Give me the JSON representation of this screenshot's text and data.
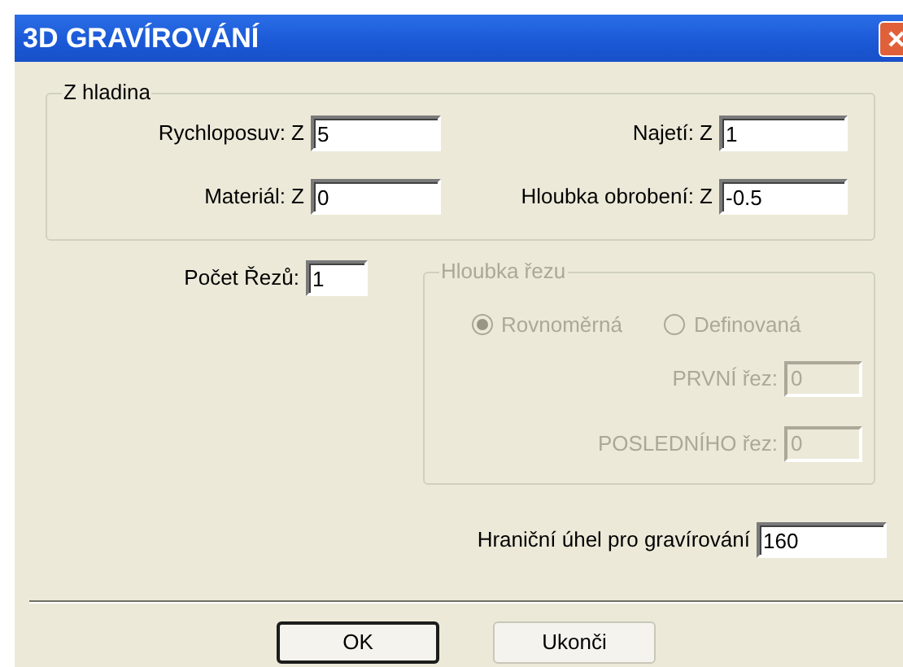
{
  "window": {
    "title": "3D GRAVÍROVÁNÍ"
  },
  "z_level": {
    "title": "Z hladina",
    "fields": [
      {
        "label": "Rychloposuv: Z",
        "value": "5"
      },
      {
        "label": "Najetí: Z",
        "value": "1"
      },
      {
        "label": "Materiál: Z",
        "value": "0"
      },
      {
        "label": "Hloubka obrobení: Z",
        "value": "-0.5"
      }
    ]
  },
  "cut_count": {
    "label": "Počet Řezů:",
    "value": "1"
  },
  "cut_depth": {
    "title": "Hloubka řezu",
    "disabled": true,
    "options": [
      {
        "label": "Rovnoměrná",
        "selected": true
      },
      {
        "label": "Definovaná",
        "selected": false
      }
    ],
    "fields": [
      {
        "label": "PRVNÍ řez:",
        "value": "0"
      },
      {
        "label": "POSLEDNÍHO řez:",
        "value": "0"
      }
    ]
  },
  "angle": {
    "label": "Hraniční úhel pro gravírování",
    "value": "160"
  },
  "buttons": [
    {
      "label": "OK",
      "default": true
    },
    {
      "label": "Ukonči",
      "default": false
    }
  ]
}
